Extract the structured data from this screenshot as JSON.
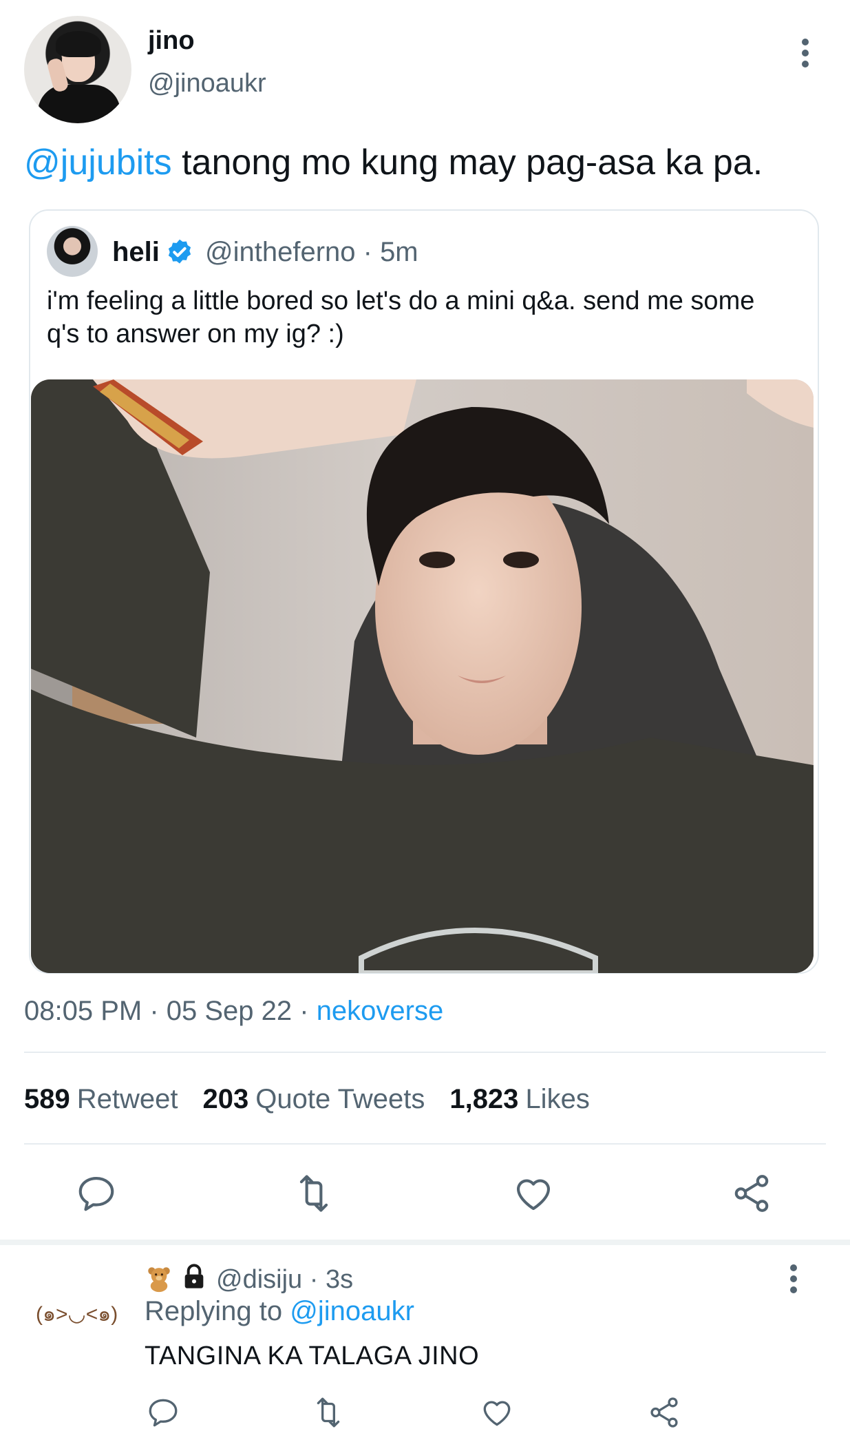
{
  "tweet": {
    "author_name": "jino",
    "author_handle": "@jinoaukr",
    "mention": "@jujubits",
    "text": " tanong mo kung may pag-asa ka pa.",
    "timestamp": "08:05 PM · 05 Sep 22 · ",
    "source": "nekoverse"
  },
  "quoted": {
    "name": "heli",
    "handle_time": "@intheferno · 5m",
    "text": "i'm feeling a little bored so let's do a mini q&a. send me some q's to answer on my ig? :)"
  },
  "stats": {
    "retweets_count": "589",
    "retweets_label": "Retweet",
    "quotes_count": "203",
    "quotes_label": "Quote Tweets",
    "likes_count": "1,823",
    "likes_label": "Likes"
  },
  "reply": {
    "emote": "(๑>◡<๑)",
    "handle_time": "@disiju · 3s",
    "replying_prefix": "Replying to ",
    "replying_handle": "@jinoaukr",
    "text": "TANGINA KA TALAGA JINO"
  },
  "colors": {
    "accent": "#1d9bf0",
    "secondary_text": "#536471",
    "primary_text": "#0f1419"
  },
  "icons": [
    "more-icon",
    "verified-icon",
    "reply-icon",
    "retweet-icon",
    "like-icon",
    "share-icon",
    "teddy-bear-icon",
    "lock-icon"
  ]
}
